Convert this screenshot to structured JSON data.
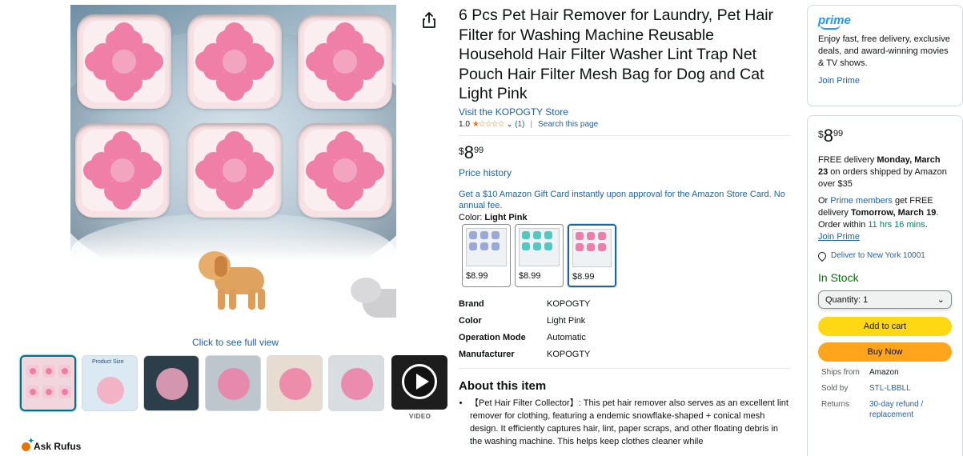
{
  "product": {
    "title": "6 Pcs Pet Hair Remover for Laundry, Pet Hair Filter for Washing Machine Reusable Household Hair Filter Washer Lint Trap Net Pouch Hair Filter Mesh Bag for Dog and Cat Light Pink",
    "store_link": "Visit the KOPOGTY Store",
    "rating": "1.0",
    "stars": "★☆☆☆☆",
    "review_count": "(1)",
    "search_link": "Search this page",
    "price": {
      "symbol": "$",
      "whole": "8",
      "fraction": "99"
    },
    "price_history": "Price history",
    "gift_card": "Get a $10 Amazon Gift Card instantly upon approval for the Amazon Store Card. No annual fee.",
    "color_label": "Color:",
    "color_value": "Light Pink",
    "swatches": [
      {
        "price": "$8.99",
        "tint": "#9aa9d8"
      },
      {
        "price": "$8.99",
        "tint": "#53c7c0"
      },
      {
        "price": "$8.99",
        "tint": "#ee7ea6"
      }
    ],
    "specs": [
      {
        "key": "Brand",
        "value": "KOPOGTY"
      },
      {
        "key": "Color",
        "value": "Light Pink"
      },
      {
        "key": "Operation Mode",
        "value": "Automatic"
      },
      {
        "key": "Manufacturer",
        "value": "KOPOGTY"
      }
    ],
    "about_title": "About this item",
    "about_items": [
      "【Pet Hair Filter Collector】: This pet hair remover also serves as an excellent lint remover for clothing, featuring a endemic snowflake-shaped + conical mesh design. It efficiently captures hair, lint, paper scraps, and other floating debris in the washing machine. This helps keep clothes cleaner while"
    ]
  },
  "media": {
    "click_full": "Click to see full view",
    "video_label": "VIDEO",
    "thumb_count": 7,
    "thumb_caption": "Product Size"
  },
  "rufus": {
    "label": "Ask Rufus"
  },
  "prime_box": {
    "logo": "prime",
    "description": "Enjoy fast, free delivery, exclusive deals, and award-winning movies & TV shows.",
    "join": "Join Prime"
  },
  "buy_box": {
    "price": {
      "symbol": "$",
      "whole": "8",
      "fraction": "99"
    },
    "free_delivery_prefix": "FREE delivery ",
    "free_delivery_date": "Monday, March 23",
    "free_delivery_suffix": " on orders shipped by Amazon over $35",
    "or_text": "Or ",
    "prime_members": "Prime members",
    "get_free": " get FREE delivery ",
    "fast_date": "Tomorrow, March 19",
    "order_within": ". Order within ",
    "countdown": "11 hrs 16 mins",
    "period": ".",
    "join_prime": "Join Prime",
    "deliver_to": "Deliver to New York 10001",
    "stock": "In Stock",
    "quantity": "Quantity: 1",
    "add_to_cart": "Add to cart",
    "buy_now": "Buy Now",
    "info": [
      {
        "key": "Ships from",
        "value": "Amazon",
        "link": false
      },
      {
        "key": "Sold by",
        "value": "STL-LBBLL",
        "link": true
      },
      {
        "key": "Returns",
        "value": "30-day refund / replacement",
        "link": true
      }
    ]
  },
  "colors": {
    "link": "#2162a1",
    "cart_yellow": "#ffd814",
    "buy_orange": "#ffa41c",
    "stock_green": "#007600",
    "prime_blue": "#1a98ff",
    "star_orange": "#de7921"
  }
}
